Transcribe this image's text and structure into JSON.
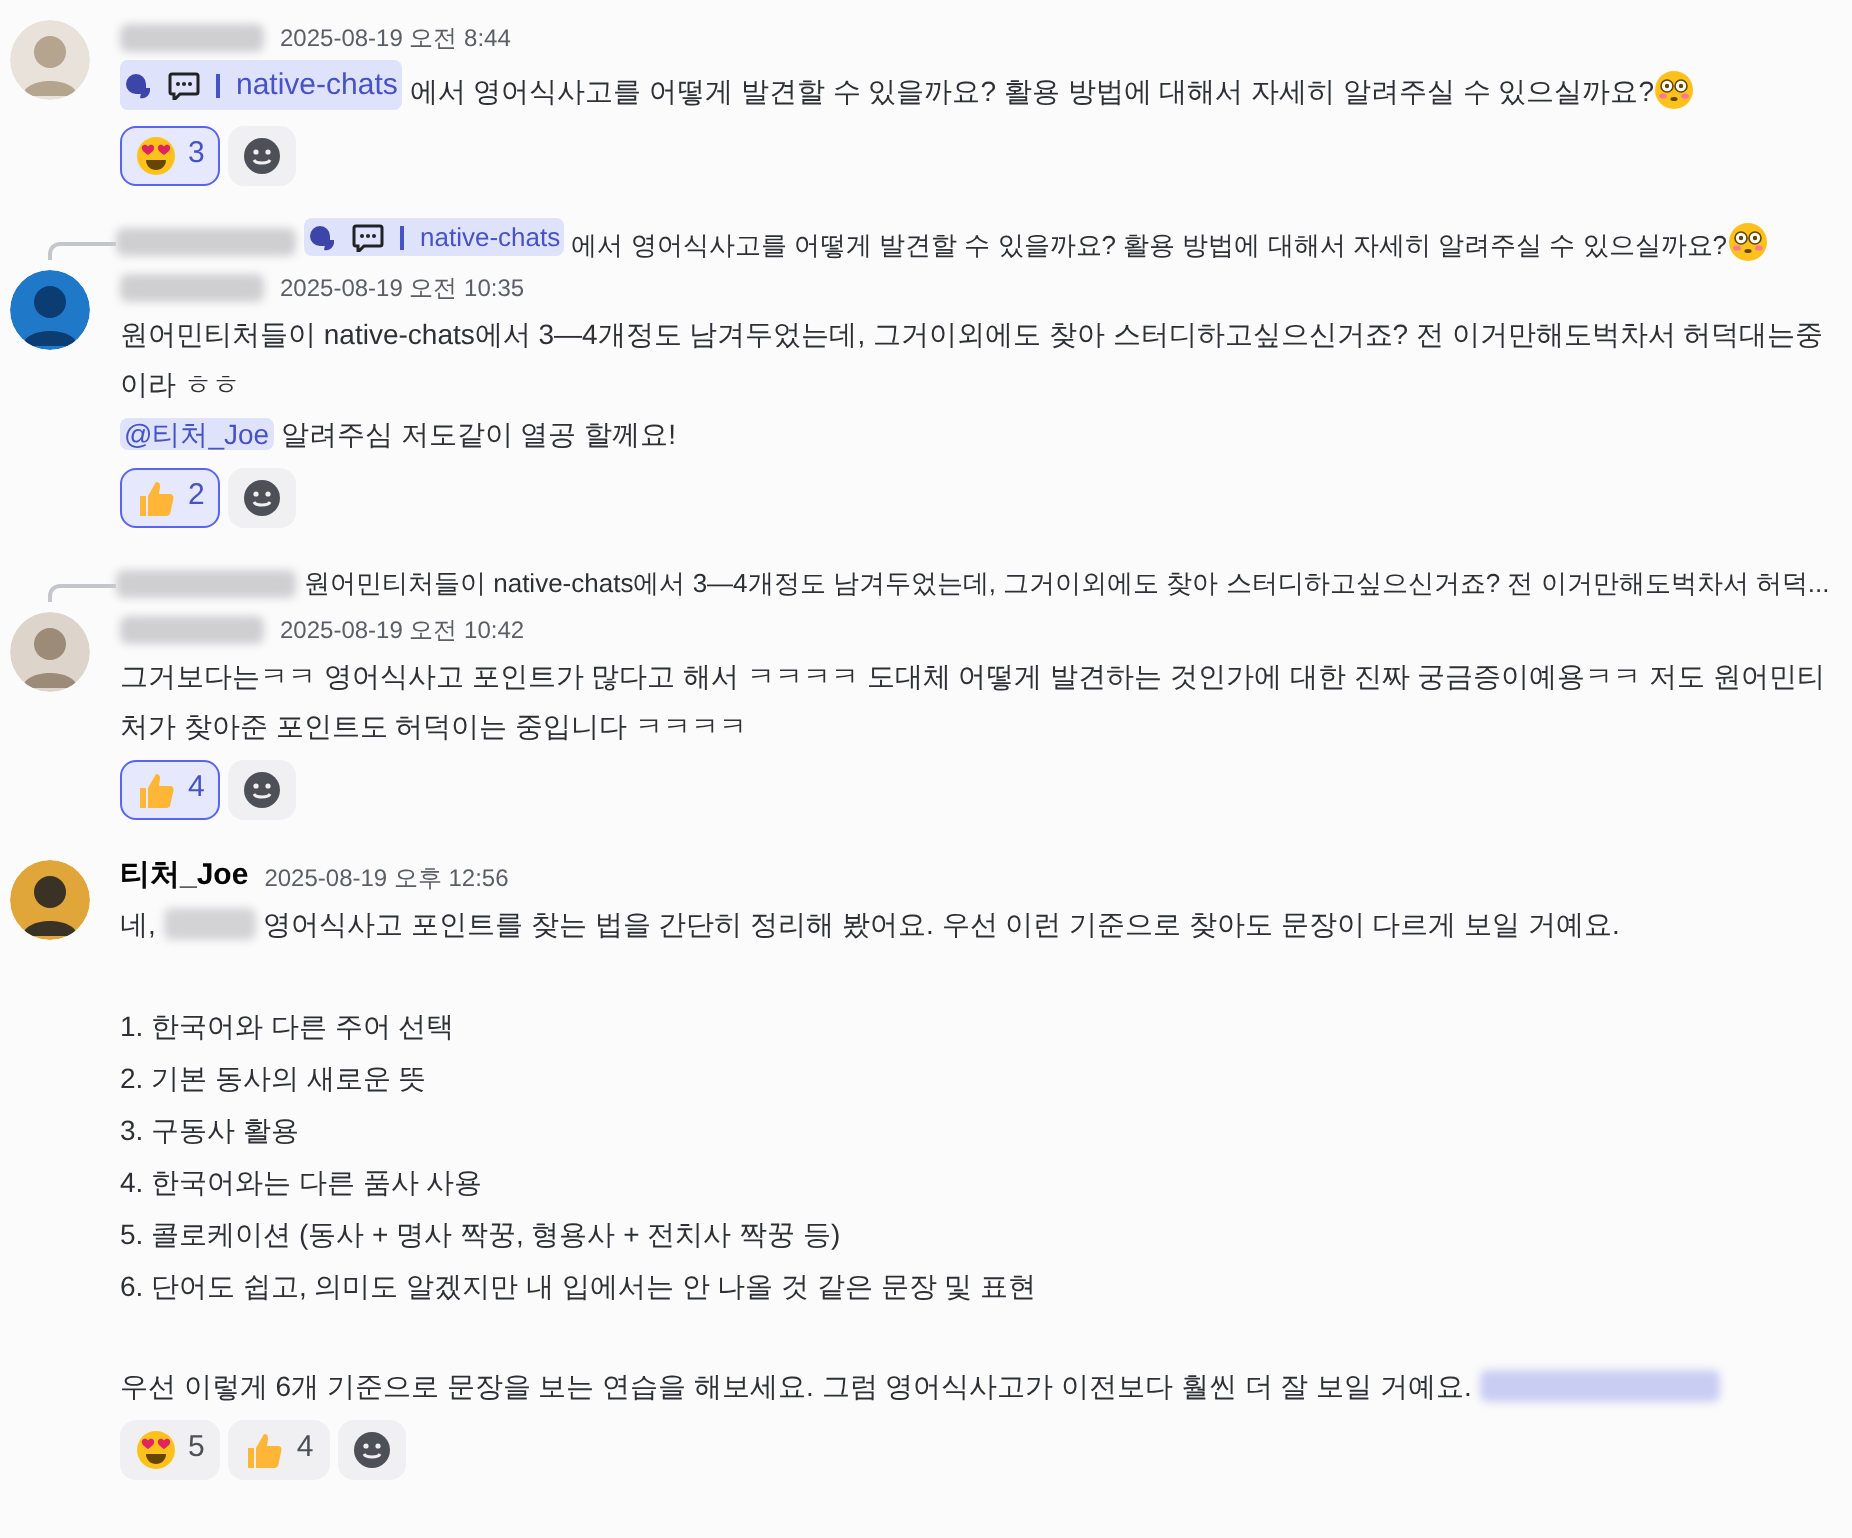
{
  "messages": [
    {
      "author_blurred": true,
      "time": "2025-08-19 오전 8:44",
      "content": [
        {
          "kind": "paragraph",
          "segments": [
            {
              "kind": "channel",
              "text": "native-chats"
            },
            {
              "kind": "text",
              "text": " 에서 영어식사고를 어떻게 발견할 수 있을까요? 활용 방법에 대해서 자세히 알려주실 수 있으실까요?"
            },
            {
              "kind": "flushed"
            }
          ]
        }
      ],
      "reactions": [
        {
          "kind": "heart_eyes",
          "count": "3",
          "selected": true
        }
      ]
    },
    {
      "reply": [
        {
          "kind": "channel",
          "text": "native-chats"
        },
        {
          "kind": "text",
          "text": " 에서 영어식사고를 어떻게 발견할 수 있을까요? 활용 방법에 대해서 자세히 알려주실 수 있으실까요?"
        },
        {
          "kind": "flushed"
        }
      ],
      "author_blurred": true,
      "time": "2025-08-19 오전 10:35",
      "content": [
        {
          "kind": "paragraph",
          "segments": [
            {
              "kind": "text",
              "text": "원어민티처들이 native-chats에서 3—4개정도 남겨두었는데, 그거이외에도 찾아 스터디하고싶으신거죠? 전 이거만해도벅차서 허덕대는중이라 ㅎㅎ"
            }
          ]
        },
        {
          "kind": "paragraph",
          "segments": [
            {
              "kind": "mention",
              "text": "@티처_Joe"
            },
            {
              "kind": "text",
              "text": " 알려주심 저도같이 열공 할께요!"
            }
          ]
        }
      ],
      "reactions": [
        {
          "kind": "thumbs_up",
          "count": "2",
          "selected": true
        }
      ]
    },
    {
      "reply": [
        {
          "kind": "text",
          "text": "원어민티처들이 native-chats에서 3—4개정도 남겨두었는데, 그거이외에도 찾아 스터디하고싶으신거죠? 전 이거만해도벅차서 허덕..."
        }
      ],
      "author_blurred": true,
      "time": "2025-08-19 오전 10:42",
      "content": [
        {
          "kind": "paragraph",
          "segments": [
            {
              "kind": "text",
              "text": "그거보다는ㅋㅋ 영어식사고 포인트가 많다고 해서 ㅋㅋㅋㅋ 도대체 어떻게 발견하는 것인가에 대한 진짜 궁금증이예용ㅋㅋ 저도 원어민티처가 찾아준 포인트도 허덕이는 중입니다 ㅋㅋㅋㅋ"
            }
          ]
        }
      ],
      "reactions": [
        {
          "kind": "thumbs_up",
          "count": "4",
          "selected": true
        }
      ]
    },
    {
      "author": "티처_Joe",
      "author_blurred": false,
      "time": "2025-08-19 오후 12:56",
      "content": [
        {
          "kind": "paragraph",
          "segments": [
            {
              "kind": "text",
              "text": "네, "
            },
            {
              "kind": "blur"
            },
            {
              "kind": "text",
              "text": " 영어식사고 포인트를 찾는 법을 간단히 정리해 봤어요. 우선 이런 기준으로 찾아도 문장이 다르게 보일 거예요."
            }
          ]
        },
        {
          "kind": "list",
          "items": [
            "1. 한국어와 다른 주어 선택",
            "2. 기본 동사의 새로운 뜻",
            "3. 구동사 활용",
            "4. 한국어와는 다른 품사 사용",
            "5. 콜로케이션 (동사 + 명사 짝꿍, 형용사 + 전치사 짝꿍 등)",
            "6. 단어도 쉽고, 의미도 알겠지만 내 입에서는 안 나올 것 같은 문장 및 표현"
          ]
        },
        {
          "kind": "paragraph",
          "segments": [
            {
              "kind": "text",
              "text": "우선 이렇게 6개 기준으로 문장을 보는 연습을 해보세요. 그럼 영어식사고가 이전보다 훨씬 더 잘 보일 거예요. "
            },
            {
              "kind": "blur_mention"
            }
          ]
        }
      ],
      "reactions": [
        {
          "kind": "heart_eyes",
          "count": "5",
          "selected": false
        },
        {
          "kind": "thumbs_up",
          "count": "4",
          "selected": false
        }
      ]
    }
  ]
}
